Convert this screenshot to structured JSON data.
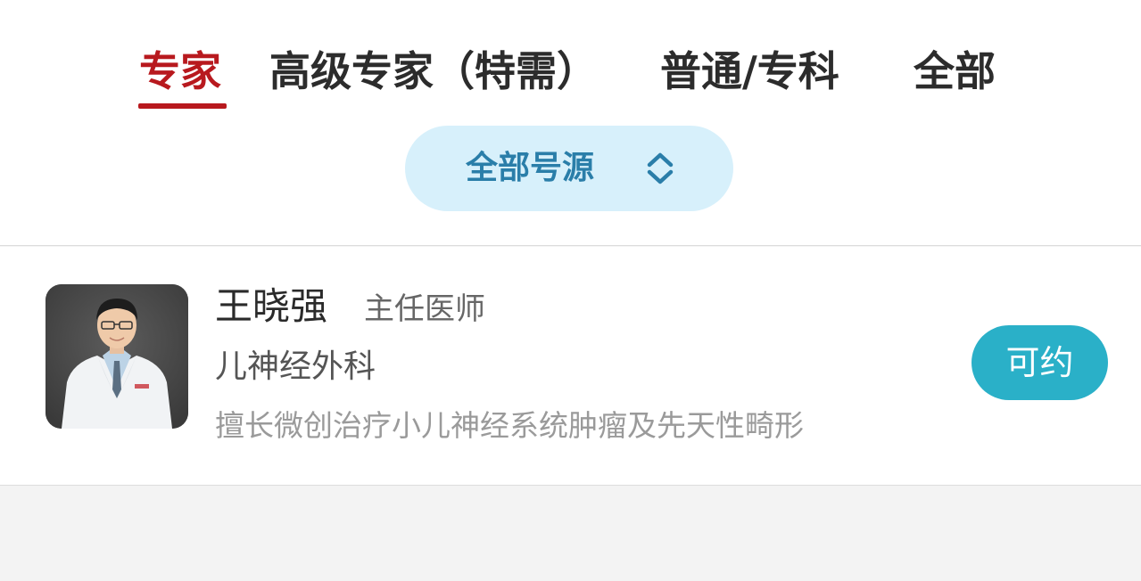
{
  "tabs": [
    {
      "label": "专家",
      "active": true
    },
    {
      "label": "高级专家（特需）",
      "active": false
    },
    {
      "label": "普通/专科",
      "active": false
    },
    {
      "label": "全部",
      "active": false
    }
  ],
  "filter": {
    "label": "全部号源",
    "icon": "up-down-chevron-icon"
  },
  "doctor": {
    "name": "王晓强",
    "title": "主任医师",
    "department": "儿神经外科",
    "specialty": "擅长微创治疗小儿神经系统肿瘤及先天性畸形",
    "book_label": "可约"
  },
  "colors": {
    "accent_red": "#b8191e",
    "filter_bg": "#d7f0fb",
    "filter_text": "#2a7ea9",
    "book_button": "#2ab0c8"
  }
}
